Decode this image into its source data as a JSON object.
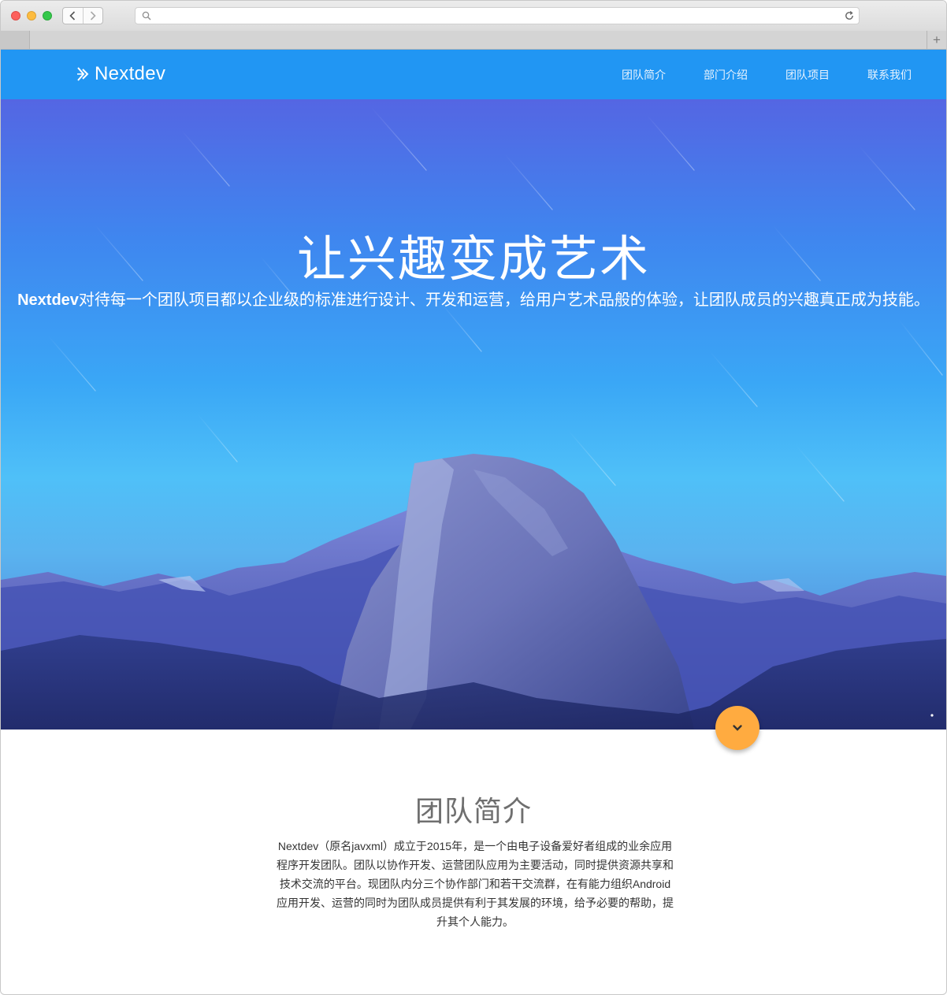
{
  "browser": {
    "address_value": "",
    "tab_add_glyph": "+"
  },
  "site": {
    "brand": "Nextdev",
    "nav": [
      "团队简介",
      "部门介绍",
      "团队项目",
      "联系我们"
    ]
  },
  "hero": {
    "title": "让兴趣变成艺术",
    "subtitle_brand": "Nextdev",
    "subtitle_rest": "对待每一个团队项目都以企业级的标准进行设计、开发和运营，给用户艺术品般的体验，让团队成员的兴趣真正成为技能。"
  },
  "intro": {
    "title": "团队简介",
    "body": "Nextdev（原名javxml）成立于2015年，是一个由电子设备爱好者组成的业余应用程序开发团队。团队以协作开发、运营团队应用为主要活动，同时提供资源共享和技术交流的平台。现团队内分三个协作部门和若干交流群，在有能力组织Android应用开发、运营的同时为团队成员提供有利于其发展的环境，给予必要的帮助，提升其个人能力。"
  },
  "colors": {
    "header": "#2196f3",
    "fab": "#ffab40"
  },
  "icons": [
    "back-icon",
    "forward-icon",
    "search-icon",
    "reload-icon",
    "plus-icon",
    "nextdev-logo-icon",
    "chevron-down-icon"
  ]
}
